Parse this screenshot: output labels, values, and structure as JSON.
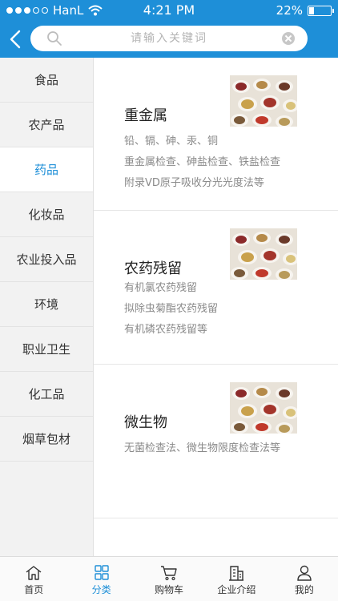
{
  "status": {
    "carrier": "HanL",
    "time": "4:21 PM",
    "battery": "22%",
    "battery_level": 0.22
  },
  "search": {
    "placeholder": "请输入关键词"
  },
  "sidebar": {
    "items": [
      {
        "label": "食品"
      },
      {
        "label": "农产品"
      },
      {
        "label": "药品"
      },
      {
        "label": "化妆品"
      },
      {
        "label": "农业投入品"
      },
      {
        "label": "环境"
      },
      {
        "label": "职业卫生"
      },
      {
        "label": "化工品"
      },
      {
        "label": "烟草包材"
      }
    ],
    "active_index": 2
  },
  "cards": [
    {
      "title": "重金属",
      "lines": [
        "铅、镉、砷、汞、铜",
        "重金属检查、砷盐检查、铁盐检查",
        "附录VD原子吸收分光光度法等"
      ]
    },
    {
      "title": "农药残留",
      "lines": [
        "有机氯农药残留",
        "拟除虫菊酯农药残留",
        "有机磷农药残留等"
      ]
    },
    {
      "title": "微生物",
      "lines": [
        "无菌检查法、微生物限度检查法等"
      ]
    }
  ],
  "tabbar": {
    "tabs": [
      {
        "label": "首页",
        "icon": "home-icon"
      },
      {
        "label": "分类",
        "icon": "grid-icon"
      },
      {
        "label": "购物车",
        "icon": "cart-icon"
      },
      {
        "label": "企业介绍",
        "icon": "building-icon"
      },
      {
        "label": "我的",
        "icon": "user-icon"
      }
    ],
    "active_index": 1
  },
  "colors": {
    "accent": "#1e8fd8"
  }
}
